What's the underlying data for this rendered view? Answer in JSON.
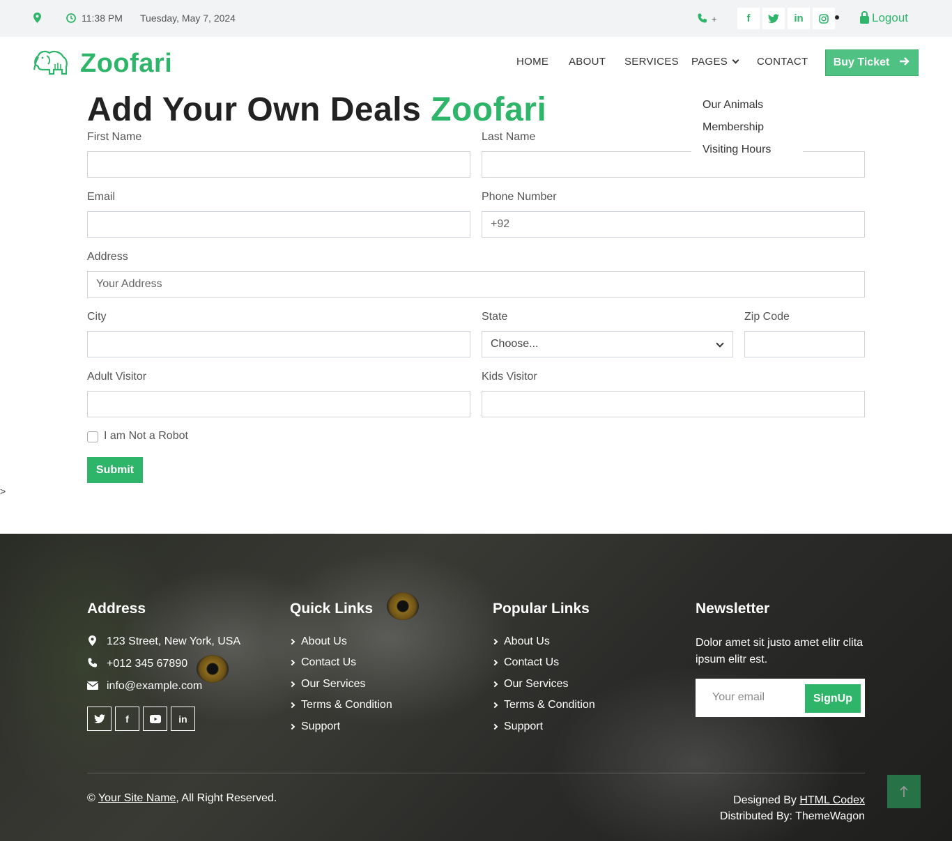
{
  "topbar": {
    "time": "11:38 PM",
    "date": "Tuesday, May 7, 2024",
    "phone_text": "+",
    "social": [
      "facebook-icon",
      "twitter-icon",
      "linkedin-icon",
      "instagram-icon"
    ],
    "logout": "Logout"
  },
  "brand": {
    "name": "Zoofari",
    "accent_color": "#2fb56a"
  },
  "nav": {
    "home": "HOME",
    "about": "ABOUT",
    "services": "SERVICES",
    "pages": "PAGES",
    "contact": "CONTACT",
    "buy_ticket": "Buy Ticket"
  },
  "pages_dropdown": [
    "Our Animals",
    "Membership",
    "Visiting Hours"
  ],
  "form": {
    "title_main": "Add Your Own Deals",
    "title_accent": "Zoofari",
    "first_name_label": "First Name",
    "last_name_label": "Last Name",
    "email_label": "Email",
    "phone_label": "Phone Number",
    "phone_value": "+92",
    "address_label": "Address",
    "address_placeholder": "Your Address",
    "city_label": "City",
    "state_label": "State",
    "state_value": "Choose...",
    "zip_label": "Zip Code",
    "adult_label": "Adult Visitor",
    "kids_label": "Kids Visitor",
    "robot_label": "I am Not a Robot",
    "submit": "Submit",
    "stray_text": ">"
  },
  "footer": {
    "address_title": "Address",
    "address": "123 Street, New York, USA",
    "phone": "+012 345 67890",
    "email": "info@example.com",
    "social": [
      "twitter-icon",
      "facebook-icon",
      "youtube-icon",
      "linkedin-icon"
    ],
    "quick_title": "Quick Links",
    "quick_links": [
      "About Us",
      "Contact Us",
      "Our Services",
      "Terms & Condition",
      "Support"
    ],
    "popular_title": "Popular Links",
    "popular_links": [
      "About Us",
      "Contact Us",
      "Our Services",
      "Terms & Condition",
      "Support"
    ],
    "newsletter_title": "Newsletter",
    "newsletter_desc": "Dolor amet sit justo amet elitr clita ipsum elitr est.",
    "newsletter_placeholder": "Your email",
    "signup": "SignUp",
    "copyright_symbol": "©",
    "site_name": "Your Site Name",
    "rights": ", All Right Reserved.",
    "designed_by": "Designed By",
    "designer": "HTML Codex",
    "distributed": "Distributed By: ThemeWagon"
  }
}
